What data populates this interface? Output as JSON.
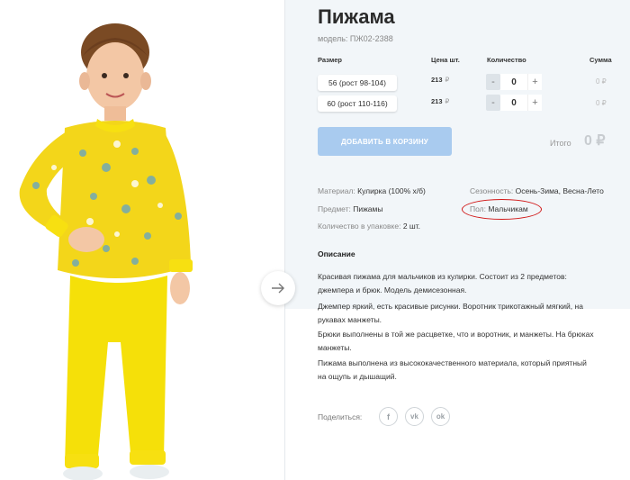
{
  "product": {
    "title": "Пижама",
    "model": "модель: ПЖ02-2388"
  },
  "table": {
    "headers": {
      "size": "Размер",
      "price": "Цена шт.",
      "qty": "Количество",
      "sum": "Сумма"
    },
    "rows": [
      {
        "size": "56 (рост 98-104)",
        "price": "213",
        "currency": "₽",
        "qty": "0",
        "minus": "-",
        "plus": "+",
        "sum": "0 ₽"
      },
      {
        "size": "60 (рост 110-116)",
        "price": "213",
        "currency": "₽",
        "qty": "0",
        "minus": "-",
        "plus": "+",
        "sum": "0 ₽"
      }
    ]
  },
  "cart": {
    "add_label": "ДОБАВИТЬ В КОРЗИНУ",
    "total_label": "Итого",
    "total_value": "0 ₽"
  },
  "attributes": {
    "material_key": "Материал:",
    "material_val": "Кулирка (100% х/б)",
    "season_key": "Сезонность:",
    "season_val": "Осень-Зима, Весна-Лето",
    "subject_key": "Предмет:",
    "subject_val": "Пижамы",
    "gender_key": "Пол:",
    "gender_val": "Мальчикам",
    "pack_key": "Количество в упаковке:",
    "pack_val": "2 шт."
  },
  "description": {
    "heading": "Описание",
    "p1": "Красивая пижама для мальчиков из кулирки. Состоит из 2 предметов:",
    "p1b": "джемпера и брюк. Модель демисезонная.",
    "p2": "Джемпер яркий, есть красивые рисунки. Воротник трикотажный мягкий, на",
    "p2b": "рукавах манжеты.",
    "p3": "Брюки выполнены в той же расцветке, что и воротник, и манжеты. На брюках",
    "p3b": "манжеты.",
    "p4": "Пижама выполнена из  высококачественного материала, который приятный",
    "p4b": "на ощупь и дышащий."
  },
  "share": {
    "label": "Поделиться:",
    "networks": [
      "f",
      "vk",
      "ok"
    ]
  },
  "colors": {
    "accent_button": "#a9cbef",
    "highlight_circle": "#d11818",
    "garment_yellow": "#f7e011"
  }
}
